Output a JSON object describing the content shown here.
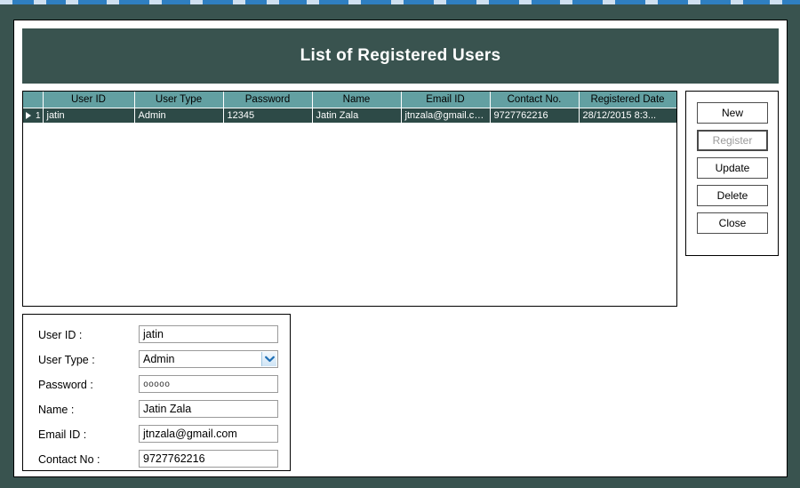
{
  "window": {
    "frame_color": "#39534f",
    "client_bg": "#ffffff"
  },
  "taskbar": {
    "bg_color": "#2f7fc1",
    "segment_color": "#cfe0f0"
  },
  "header": {
    "title": "List of Registered Users",
    "bg_color": "#39534f",
    "text_color": "#ffffff"
  },
  "grid": {
    "header_bg": "#63a0a2",
    "row_bg": "#2d4a47",
    "row_text": "#ffffff",
    "row_indicator": "1",
    "columns": [
      "User ID",
      "User Type",
      "Password",
      "Name",
      "Email ID",
      "Contact No.",
      "Registered Date"
    ],
    "rows": [
      {
        "user_id": "jatin",
        "user_type": "Admin",
        "password": "12345",
        "name": "Jatin Zala",
        "email_id": "jtnzala@gmail.com",
        "contact_no": "9727762216",
        "registered_date": "28/12/2015 8:3..."
      }
    ]
  },
  "actions": {
    "buttons": [
      {
        "label": "New",
        "state": "enabled"
      },
      {
        "label": "Register",
        "state": "disabled"
      },
      {
        "label": "Update",
        "state": "enabled"
      },
      {
        "label": "Delete",
        "state": "enabled"
      },
      {
        "label": "Close",
        "state": "enabled"
      }
    ]
  },
  "form": {
    "fields": [
      {
        "label": "User ID :",
        "value": "jatin",
        "type": "text"
      },
      {
        "label": "User Type :",
        "value": "Admin",
        "type": "select"
      },
      {
        "label": "Password :",
        "value": "ooooo",
        "type": "password"
      },
      {
        "label": "Name :",
        "value": "Jatin Zala",
        "type": "text"
      },
      {
        "label": "Email ID :",
        "value": "jtnzala@gmail.com",
        "type": "text"
      },
      {
        "label": "Contact No :",
        "value": "9727762216",
        "type": "text"
      }
    ],
    "user_type_options": [
      "Admin"
    ]
  }
}
